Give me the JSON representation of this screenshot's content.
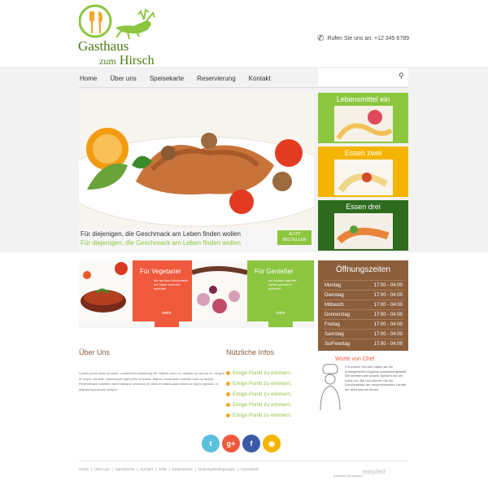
{
  "header": {
    "logo_line1": "Gasthaus",
    "logo_line2": "zum",
    "logo_line3": "Hirsch",
    "phone": "Rufen Sie uns an: +12 345 6789"
  },
  "nav": {
    "items": [
      "Home",
      "Über uns",
      "Speisekarte",
      "Reservierung",
      "Kontakt"
    ]
  },
  "hero": {
    "caption1": "Für diejenigen, die Geschmack am Leben finden wollen",
    "caption2": "Für diejenigen, die Geschmack am Leben finden wollen",
    "cta_line1": "JETZT",
    "cta_line2": "BESTELLEN"
  },
  "side_tiles": [
    {
      "label": "Lebensmittel ein",
      "color": "#8cc63f"
    },
    {
      "label": "Essen zwei",
      "color": "#f5b400"
    },
    {
      "label": "Essen drei",
      "color": "#2e6b1f"
    }
  ],
  "promo": {
    "veg_title": "Für Vegetarier",
    "veg_text": "die auf den Geschmack der Natur kommen möchten.",
    "veg_more": "mehr",
    "gen_title": "Für Genießer",
    "gen_text": "die einfach mal das Leben genießen möchten.",
    "gen_more": "mehr"
  },
  "hours": {
    "title": "Öffnungszeiten",
    "rows": [
      {
        "day": "Montag",
        "time": "17:00 - 04:00"
      },
      {
        "day": "Dienstag",
        "time": "17:00 - 04:00"
      },
      {
        "day": "Mittwoch",
        "time": "17:00 - 04:00"
      },
      {
        "day": "Donnerstag",
        "time": "17:00 - 04:00"
      },
      {
        "day": "Freitag",
        "time": "17:00 - 04:00"
      },
      {
        "day": "Samstag",
        "time": "17:00 - 04:00"
      },
      {
        "day": "So/Feiertag",
        "time": "17:00 - 04:00"
      }
    ]
  },
  "chef": {
    "title": "Worte von Chef",
    "text": "Für unsere Kunden haben wir ein umfangreiches Angebot zusammengestellt. Wir bereiten alle unsere Speisen mit viel Liebe vor. Bei uns können Sie die Geschmäcker der verschiedensten Länder der Welt kennen lernen."
  },
  "about": {
    "title": "Über Uns",
    "text": "Lorem ipsum dolor sit amet, consectetur adipiscing elit. Mauris nunc mi, semper ac rutrum et, congue at neque. Aenean ullamcorper eget justo id lacinia. Mauris consequat molestie urna ac lacinia. Pellentesque habitant morbi tristique senectus et netus et malesuada fames ac turpis egestas. In adipiscing posuere tempor."
  },
  "useful": {
    "title": "Nützliche Infos",
    "items": [
      "Einige Punkt zu erinnern,",
      "Einige Punkt zu erinnern,",
      "Einige Punkt zu erinnern,",
      "Einige Punkt zu erinnern,",
      "Einige Punkt zu erinnern,"
    ]
  },
  "social": [
    {
      "icon": "twitter-icon",
      "glyph": "t",
      "color": "#5bc0de"
    },
    {
      "icon": "google-plus-icon",
      "glyph": "g+",
      "color": "#ef5a3c"
    },
    {
      "icon": "facebook-icon",
      "glyph": "f",
      "color": "#3b5ba8"
    },
    {
      "icon": "rss-icon",
      "glyph": "◉",
      "color": "#f5b400"
    }
  ],
  "footer": {
    "links": [
      "Home",
      "Über uns",
      "Speisekarte",
      "Kontakt",
      "AGB",
      "Datenschutz",
      "Nutzungsbedingungen",
      "Impressum"
    ],
    "powered": "powered by easyled",
    "brand": "easyled"
  }
}
